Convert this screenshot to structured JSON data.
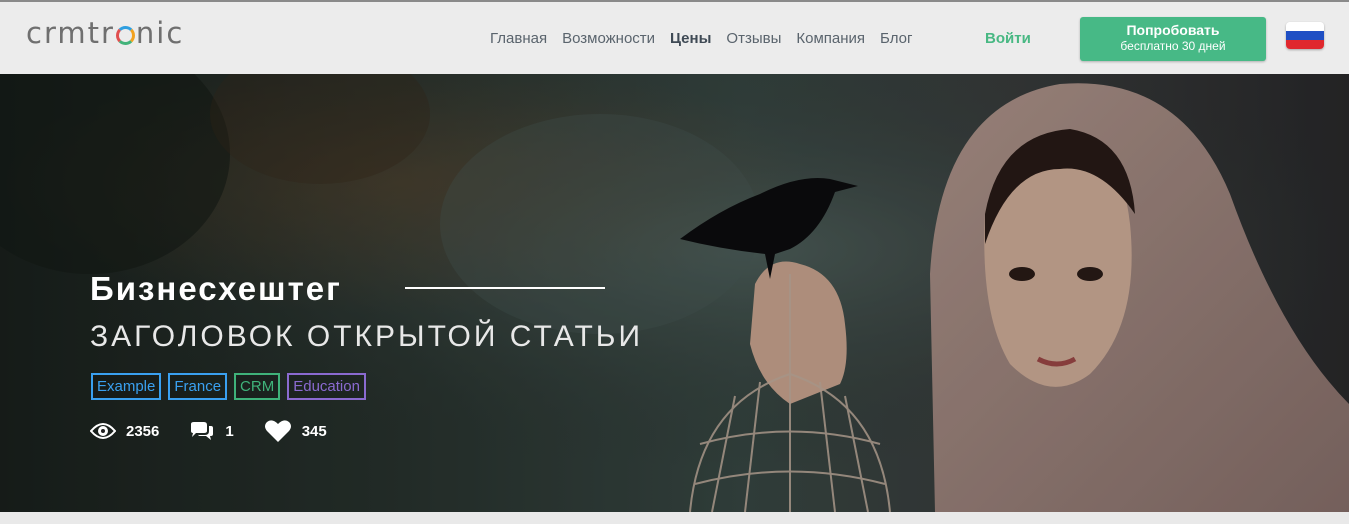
{
  "header": {
    "logo_left": "crmtr",
    "logo_right": "nic",
    "nav": [
      {
        "label": "Главная",
        "active": false
      },
      {
        "label": "Возможности",
        "active": false
      },
      {
        "label": "Цены",
        "active": true
      },
      {
        "label": "Отзывы",
        "active": false
      },
      {
        "label": "Компания",
        "active": false
      },
      {
        "label": "Блог",
        "active": false
      }
    ],
    "login_label": "Войти",
    "try_button": {
      "line1": "Попробовать",
      "line2": "бесплатно 30 дней"
    },
    "language_flag": "russia-flag-icon"
  },
  "hero": {
    "hashtag": "Бизнесхештег",
    "title": "ЗАГОЛОВОК ОТКРЫТОЙ СТАТЬИ",
    "tags": [
      {
        "label": "Example",
        "color": "#3aa0f0"
      },
      {
        "label": "France",
        "color": "#3aa0f0"
      },
      {
        "label": "CRM",
        "color": "#3fb27a"
      },
      {
        "label": "Education",
        "color": "#8a6ad0"
      }
    ],
    "stats": {
      "views": "2356",
      "comments": "1",
      "likes": "345"
    },
    "icons": {
      "views": "eye-icon",
      "comments": "comments-icon",
      "likes": "heart-icon"
    }
  },
  "colors": {
    "accent_green": "#47b986",
    "header_bg": "#ececec",
    "nav_text": "#5a646d"
  }
}
